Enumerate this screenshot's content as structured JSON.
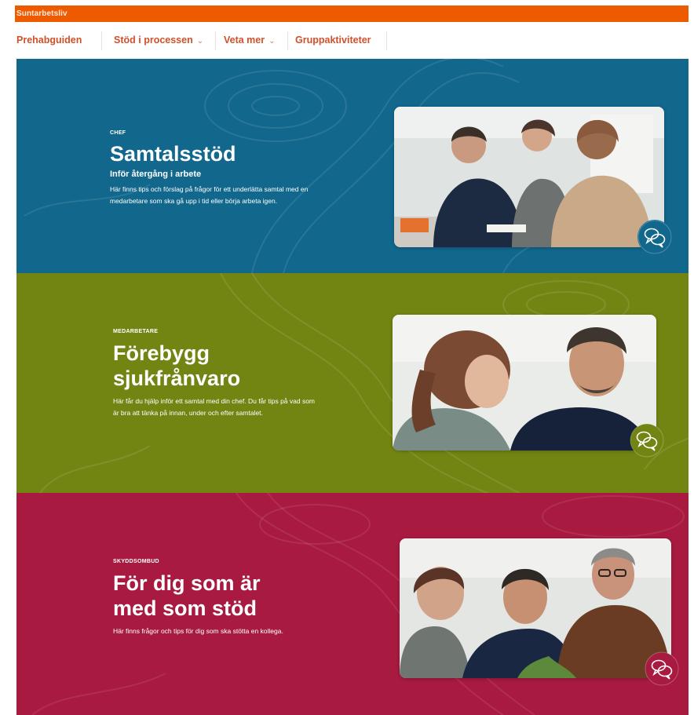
{
  "header": {
    "brand": "Suntarbetsliv"
  },
  "nav": {
    "items": [
      {
        "label": "Prehabguiden",
        "has_dropdown": false
      },
      {
        "label": "Stöd i processen",
        "has_dropdown": true
      },
      {
        "label": "Veta mer",
        "has_dropdown": true
      },
      {
        "label": "Gruppaktiviteter",
        "has_dropdown": false
      }
    ],
    "chevron": "⌄",
    "color": "#d0502a"
  },
  "cards": [
    {
      "eyebrow": "CHEF",
      "title": "Samtalsstöd",
      "subtitle": "Inför återgång i arbete",
      "body": "Här finns tips och förslag på frågor för ett underlätta samtal med en medarbetare som ska gå upp i tid eller börja arbeta igen.",
      "background": "#11678c",
      "icon": "chat-bubbles-icon"
    },
    {
      "eyebrow": "MEDARBETARE",
      "title_lines": [
        "Förebygg",
        "sjukfrånvaro"
      ],
      "body": "Här får du hjälp inför ett samtal med din chef. Du får tips på vad som är bra att tänka på innan, under och efter samtalet.",
      "background": "#728513",
      "icon": "chat-bubbles-icon"
    },
    {
      "eyebrow": "SKYDDSOMBUD",
      "title_lines": [
        "För dig som är",
        "med som stöd"
      ],
      "body": "Här finns frågor och tips för dig som ska stötta en kollega.",
      "background": "#a81a40",
      "icon": "chat-bubbles-icon"
    }
  ],
  "colors": {
    "topbar": "#ee5a00",
    "nav_text": "#d0502a"
  }
}
